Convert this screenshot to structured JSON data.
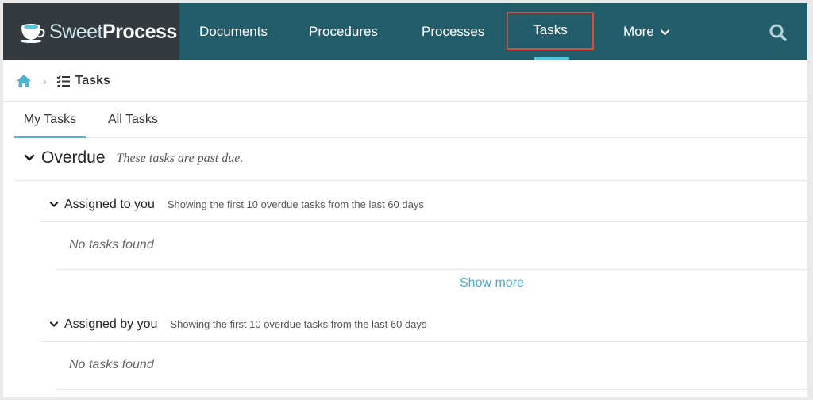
{
  "brand": {
    "name_light": "Sweet",
    "name_bold": "Process"
  },
  "nav": {
    "items": [
      {
        "label": "Documents"
      },
      {
        "label": "Procedures"
      },
      {
        "label": "Processes"
      },
      {
        "label": "Tasks"
      },
      {
        "label": "More"
      }
    ]
  },
  "breadcrumb": {
    "title": "Tasks"
  },
  "tabs": [
    {
      "label": "My Tasks"
    },
    {
      "label": "All Tasks"
    }
  ],
  "overdue": {
    "title": "Overdue",
    "description": "These tasks are past due.",
    "assigned_to_you": {
      "title": "Assigned to you",
      "description": "Showing the first 10 overdue tasks from the last 60 days",
      "empty": "No tasks found"
    },
    "show_more": "Show more",
    "assigned_by_you": {
      "title": "Assigned by you",
      "description": "Showing the first 10 overdue tasks from the last 60 days",
      "empty": "No tasks found"
    }
  },
  "colors": {
    "nav_bg": "#235d6a",
    "logo_bg": "#353a3f",
    "accent": "#4bb4cf",
    "highlight_box": "#e0483a"
  }
}
